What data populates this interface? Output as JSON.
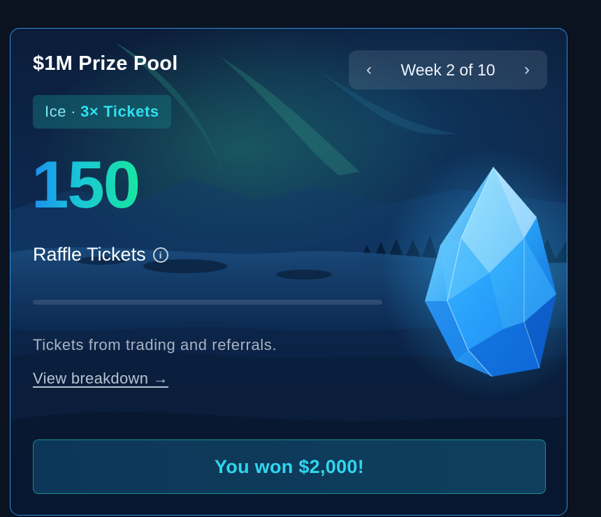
{
  "card": {
    "title": "$1M Prize Pool",
    "week_nav": {
      "prev": "‹",
      "label": "Week 2 of 10",
      "next": "›"
    },
    "badge": {
      "tier": "Ice",
      "separator": "·",
      "multiplier": "3× Tickets"
    },
    "ticket_count": "150",
    "ticket_label": "Raffle Tickets",
    "info_icon": "i",
    "progress": {
      "value": 0
    },
    "description": "Tickets from trading and referrals.",
    "breakdown_link": "View breakdown →",
    "win_button": "You won $2,000!"
  },
  "colors": {
    "border_accent": "#2f8fe0",
    "count_gradient_start": "#1a8ff0",
    "count_gradient_end": "#18e6a0",
    "button_text": "#2fd6ee",
    "badge_text": "#2fe0f0"
  },
  "icons": {
    "prev": "chevron-left-icon",
    "next": "chevron-right-icon",
    "info": "info-icon",
    "hero": "ice-crystal-icon"
  }
}
